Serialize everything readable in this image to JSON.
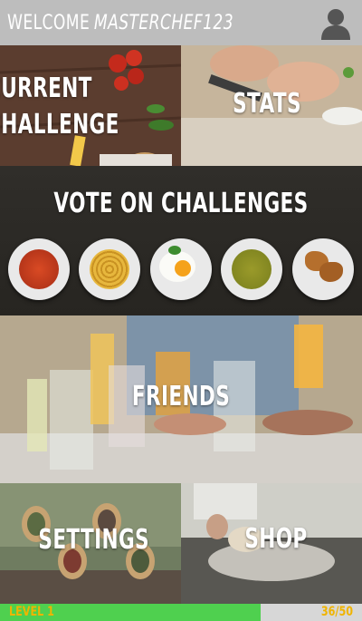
{
  "header": {
    "welcome": "WELCOME",
    "username": "MASTERCHEF123",
    "profile_icon": "user-silhouette-icon"
  },
  "tiles": {
    "current_challenge": "CURRENT\nCHALLENGE",
    "stats": "STATS",
    "vote": "VOTE ON CHALLENGES",
    "friends": "FRIENDS",
    "settings": "SETTINGS",
    "shop": "SHOP"
  },
  "vote_dishes": [
    "tomato-stew",
    "spaghetti",
    "fried-egg",
    "pea-soup",
    "croissants"
  ],
  "footer": {
    "level": "LEVEL 1",
    "xp": "36/50",
    "progress": 0.72
  },
  "colors": {
    "header_bg": "#bdbdbd",
    "progress_fill": "#4fd04f",
    "progress_track": "#d7d7d7",
    "footer_text": "#f0b400"
  }
}
